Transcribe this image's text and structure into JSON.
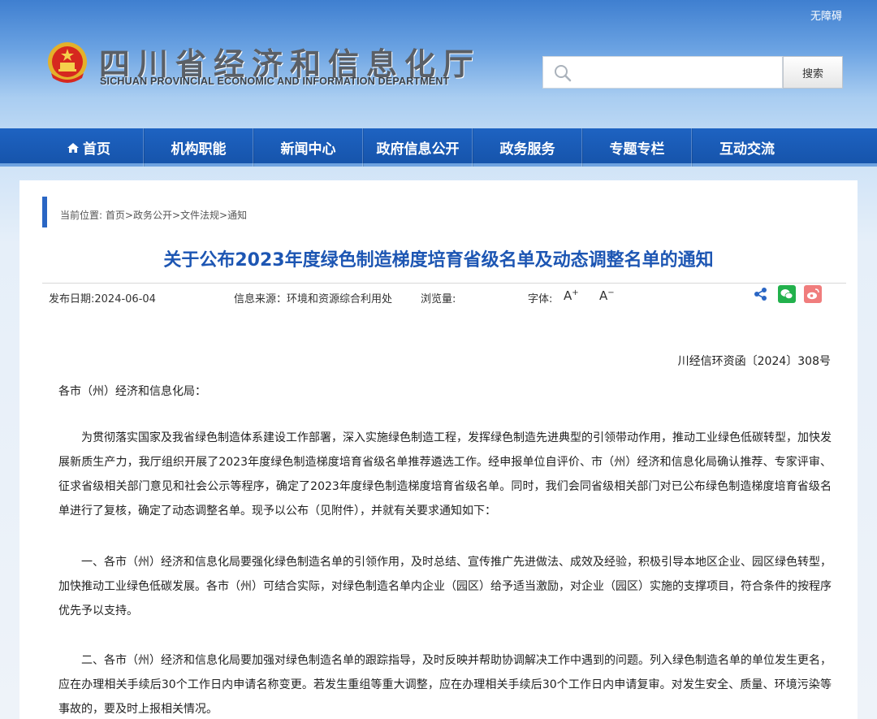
{
  "header": {
    "accessibility_label": "无障碍",
    "site_title": "四川省经济和信息化厅",
    "site_subtitle": "SICHUAN PROVINCIAL ECONOMIC AND INFORMATION DEPARTMENT",
    "search_placeholder": "",
    "search_button_label": "搜索"
  },
  "nav": {
    "items": [
      {
        "label": "首页"
      },
      {
        "label": "机构职能"
      },
      {
        "label": "新闻中心"
      },
      {
        "label": "政府信息公开"
      },
      {
        "label": "政务服务"
      },
      {
        "label": "专题专栏"
      },
      {
        "label": "互动交流"
      }
    ]
  },
  "breadcrumb": {
    "prefix": "当前位置: ",
    "items": [
      "首页",
      "政务公开",
      "文件法规",
      "通知"
    ],
    "separator": ">"
  },
  "article": {
    "title": "关于公布2023年度绿色制造梯度培育省级名单及动态调整名单的通知",
    "publish_date": "发布日期:2024-06-04",
    "source": "信息来源：环境和资源综合利用处",
    "views": "浏览量:",
    "font_label": "字体:",
    "font_increase": "A",
    "font_decrease": "A",
    "doc_number": "川经信环资函〔2024〕308号",
    "salutation": "各市（州）经济和信息化局：",
    "paragraphs": [
      "为贯彻落实国家及我省绿色制造体系建设工作部署，深入实施绿色制造工程，发挥绿色制造先进典型的引领带动作用，推动工业绿色低碳转型，加快发展新质生产力，我厅组织开展了2023年度绿色制造梯度培育省级名单推荐遴选工作。经申报单位自评价、市（州）经济和信息化局确认推荐、专家评审、征求省级相关部门意见和社会公示等程序，确定了2023年度绿色制造梯度培育省级名单。同时，我们会同省级相关部门对已公布绿色制造梯度培育省级名单进行了复核，确定了动态调整名单。现予以公布（见附件），并就有关要求通知如下：",
      "一、各市（州）经济和信息化局要强化绿色制造名单的引领作用，及时总结、宣传推广先进做法、成效及经验，积极引导本地区企业、园区绿色转型，加快推动工业绿色低碳发展。各市（州）可结合实际，对绿色制造名单内企业（园区）给予适当激励，对企业（园区）实施的支撑项目，符合条件的按程序优先予以支持。",
      "二、各市（州）经济和信息化局要加强对绿色制造名单的跟踪指导，及时反映并帮助协调解决工作中遇到的问题。列入绿色制造名单的单位发生更名，应在办理相关手续后30个工作日内申请名称变更。若发生重组等重大调整，应在办理相关手续后30个工作日内申请复审。对发生安全、质量、环境污染等事故的，要及时上报相关情况。"
    ]
  },
  "colors": {
    "nav_bg": "#1e63c2",
    "title_blue": "#1d56b3",
    "wechat_green": "#22b14c",
    "weibo_pink": "#f07d7d"
  }
}
